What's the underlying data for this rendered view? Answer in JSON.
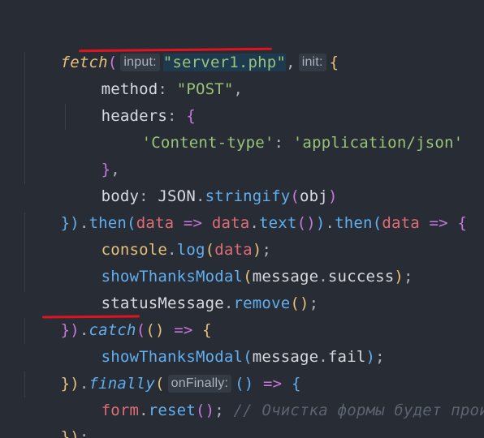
{
  "code": {
    "l1": {
      "fetch": "fetch",
      "open": "(",
      "hint_input": "input:",
      "url": "\"server1.php\"",
      "comma": ",",
      "hint_init": "init:",
      "brace": "{"
    },
    "l2": {
      "key": "method",
      "colon": ": ",
      "val": "\"POST\"",
      "comma": ","
    },
    "l3": {
      "key": "headers",
      "colon": ": ",
      "brace": "{"
    },
    "l4": {
      "key": "'Content-type'",
      "colon": ": ",
      "val": "'application/json'"
    },
    "l5": {
      "brace": "}",
      "comma": ","
    },
    "l6": {
      "key": "body",
      "colon": ": ",
      "obj": "JSON",
      "dot": ".",
      "fn": "stringify",
      "open": "(",
      "arg": "obj",
      "close": ")"
    },
    "l7": {
      "close": "})",
      "dot": ".",
      "then": "then",
      "open": "(",
      "param": "data",
      "arrow": " => ",
      "obj": "data",
      "dot2": ".",
      "fn": "text",
      "call": "()",
      "close2": ")",
      "dot3": ".",
      "then2": "then",
      "open2": "(",
      "param2": "data",
      "arrow2": " => ",
      "brace": "{"
    },
    "l8": {
      "obj": "console",
      "dot": ".",
      "fn": "log",
      "open": "(",
      "arg": "data",
      "close": ")",
      "semi": ";"
    },
    "l9": {
      "fn": "showThanksModal",
      "open": "(",
      "obj": "message",
      "dot": ".",
      "prop": "success",
      "close": ")",
      "semi": ";"
    },
    "l10": {
      "obj": "statusMessage",
      "dot": ".",
      "fn": "remove",
      "call": "()",
      "semi": ";"
    },
    "l11": {
      "close": "})",
      "dot": ".",
      "catch": "catch",
      "open": "(",
      "parens": "()",
      "arrow": " => ",
      "brace": "{"
    },
    "l12": {
      "fn": "showThanksModal",
      "open": "(",
      "obj": "message",
      "dot": ".",
      "prop": "fail",
      "close": ")",
      "semi": ";"
    },
    "l13": {
      "close": "})",
      "dot": ".",
      "finally": "finally",
      "open": "(",
      "hint": "onFinally:",
      "parens": "()",
      "arrow": " => ",
      "brace": "{"
    },
    "l14": {
      "obj": "form",
      "dot": ".",
      "fn": "reset",
      "call": "()",
      "semi": ";",
      "comment": " // Очистка формы будет проис"
    },
    "l15": {
      "close": "})",
      "semi": ";"
    }
  },
  "colors": {
    "background": "#282c34",
    "underline": "#e0131f"
  }
}
